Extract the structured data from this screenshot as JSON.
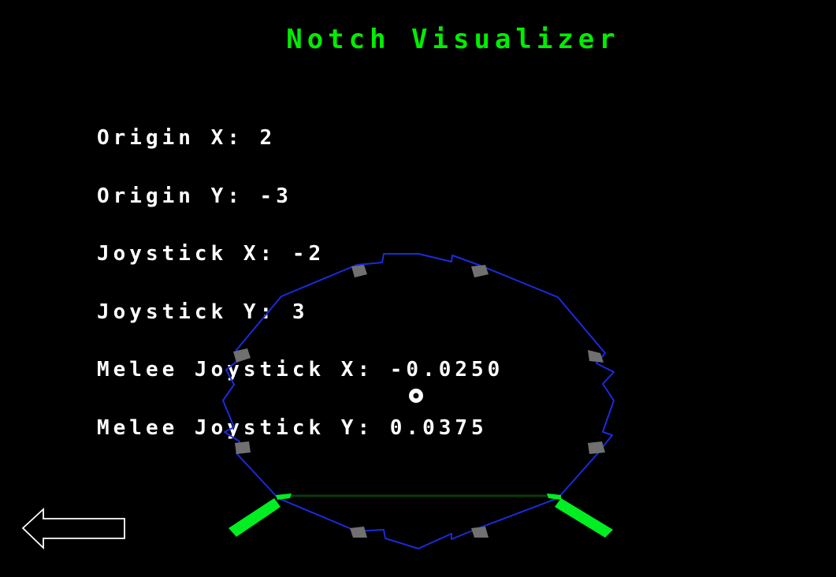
{
  "title": "Notch Visualizer",
  "readout": {
    "origin_x_label": "Origin X:",
    "origin_x": "2",
    "origin_y_label": "Origin Y:",
    "origin_y": "-3",
    "joystick_x_label": "Joystick X:",
    "joystick_x": "-2",
    "joystick_y_label": "Joystick Y:",
    "joystick_y": "3",
    "melee_x_label": "Melee Joystick X:",
    "melee_x": "-0.0250",
    "melee_y_label": "Melee Joystick Y:",
    "melee_y": "0.0375"
  },
  "colors": {
    "background": "#000000",
    "title": "#00ee00",
    "text": "#ffffff",
    "gate_outline": "#1a2bdd",
    "notch_marker": "#707070",
    "active_notch": "#00ee22",
    "joystick_cursor": "#ffffff"
  },
  "back_button": {
    "icon": "left-arrow-icon"
  }
}
